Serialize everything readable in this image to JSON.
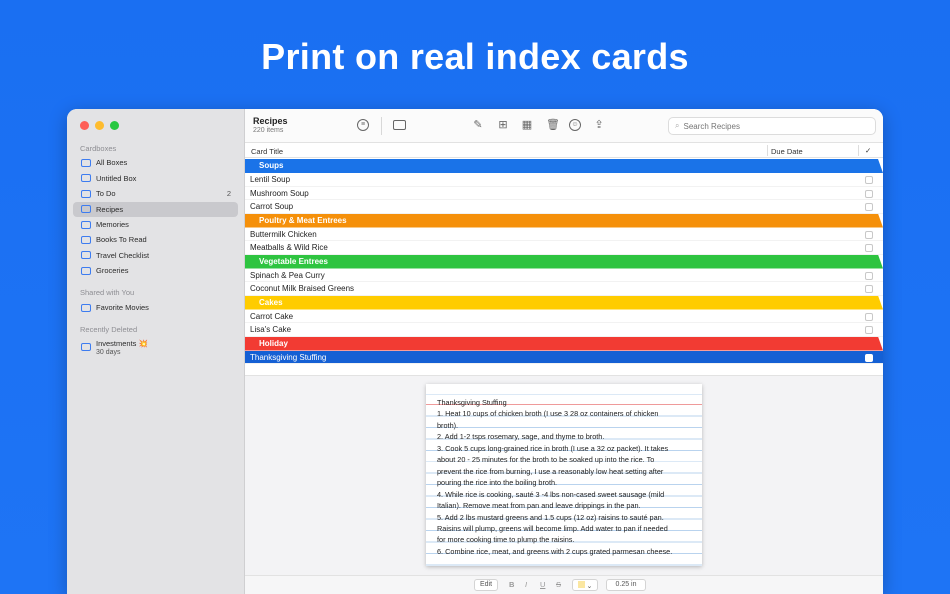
{
  "headline": "Print on real index cards",
  "sidebar": {
    "section_cardboxes": "Cardboxes",
    "items": [
      {
        "label": "All Boxes",
        "count": ""
      },
      {
        "label": "Untitled Box",
        "count": ""
      },
      {
        "label": "To Do",
        "count": "2"
      },
      {
        "label": "Recipes",
        "count": ""
      },
      {
        "label": "Memories",
        "count": ""
      },
      {
        "label": "Books To Read",
        "count": ""
      },
      {
        "label": "Travel Checklist",
        "count": ""
      },
      {
        "label": "Groceries",
        "count": ""
      }
    ],
    "section_shared": "Shared with You",
    "shared_items": [
      {
        "label": "Favorite Movies"
      }
    ],
    "section_deleted": "Recently Deleted",
    "deleted_items": [
      {
        "label": "Investments 💥",
        "sub": "30 days"
      }
    ]
  },
  "toolbar": {
    "title": "Recipes",
    "subtitle": "220 items",
    "search_placeholder": "Search Recipes"
  },
  "columns": {
    "card_title": "Card Title",
    "due_date": "Due Date",
    "check": "✓"
  },
  "groups": [
    {
      "name": "Soups",
      "color": "#1a73e8",
      "rows": [
        "Lentil Soup",
        "Mushroom Soup",
        "Carrot Soup"
      ]
    },
    {
      "name": "Poultry & Meat Entrees",
      "color": "#f5900a",
      "rows": [
        "Buttermilk Chicken",
        "Meatballs & Wild Rice"
      ]
    },
    {
      "name": "Vegetable Entrees",
      "color": "#2ec440",
      "rows": [
        "Spinach & Pea Curry",
        "Coconut Milk Braised Greens"
      ]
    },
    {
      "name": "Cakes",
      "color": "#ffcc00",
      "rows": [
        "Carrot Cake",
        "Lisa's Cake"
      ]
    },
    {
      "name": "Holiday",
      "color": "#f23b33",
      "rows": [
        "Thanksgiving Stuffing"
      ]
    }
  ],
  "card": {
    "lines": [
      "Thanksgiving Stuffing",
      "1. Heat 10 cups of chicken broth (I use 3 28 oz containers of chicken",
      "broth).",
      "2. Add 1-2 tsps rosemary, sage, and thyme to broth.",
      "3. Cook 5 cups long-grained rice in broth (I use a 32 oz packet). It takes",
      "about 20 - 25 minutes for the broth to be soaked up into the rice. To",
      "prevent the rice from burning, I use a reasonably low heat setting after",
      "pouring the rice into the boiling broth.",
      "4. While rice is cooking, sauté 3 -4 lbs non-cased sweet sausage (mild",
      "Italian). Remove meat from pan and leave drippings in the pan.",
      "5. Add 2 lbs mustard greens and 1.5 cups (12 oz) raisins to sauté pan.",
      "Raisins will plump, greens will become limp. Add water to pan if needed",
      "for more cooking time to plump the raisins.",
      "6. Combine rice, meat, and greens with 2 cups grated parmesan cheese."
    ]
  },
  "bottombar": {
    "edit": "Edit",
    "bold": "B",
    "italic": "I",
    "underline": "U",
    "strike": "S",
    "size": "0.25 in"
  }
}
